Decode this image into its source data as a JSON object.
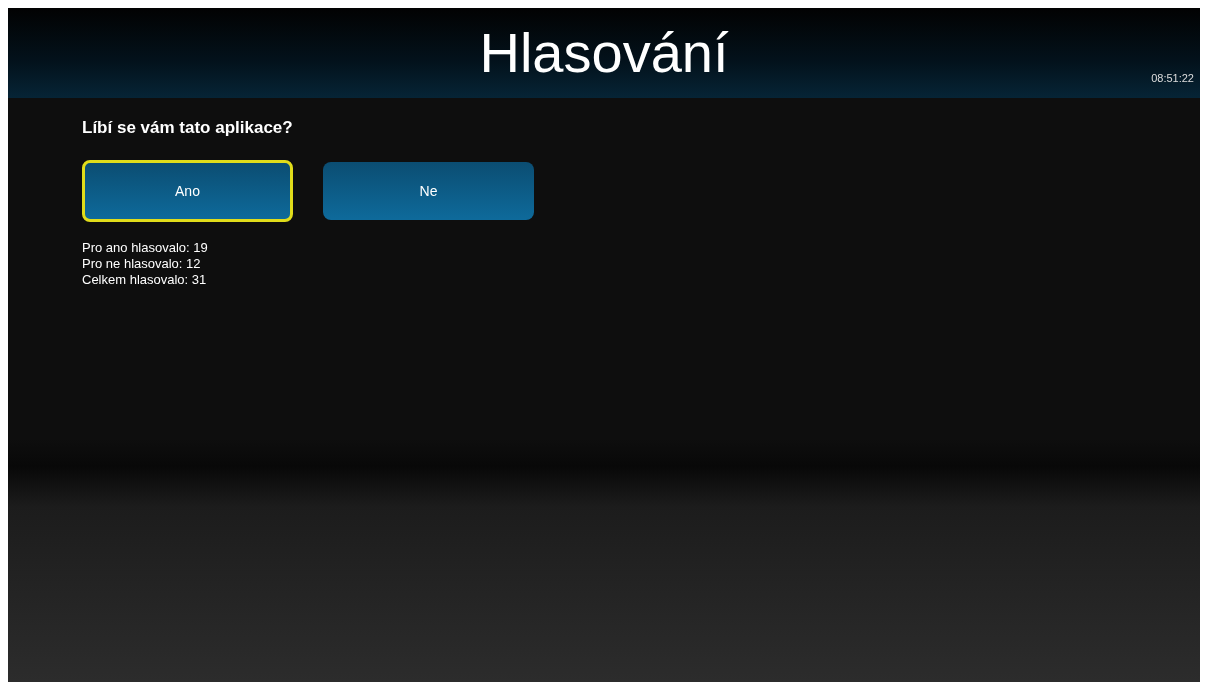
{
  "header": {
    "title": "Hlasování",
    "clock": "08:51:22"
  },
  "question": "Líbí se vám tato aplikace?",
  "buttons": [
    {
      "label": "Ano",
      "focused": true
    },
    {
      "label": "Ne",
      "focused": false
    }
  ],
  "results": [
    "Pro ano hlasovalo: 19",
    "Pro ne hlasovalo: 12",
    "Celkem hlasovalo: 31"
  ]
}
